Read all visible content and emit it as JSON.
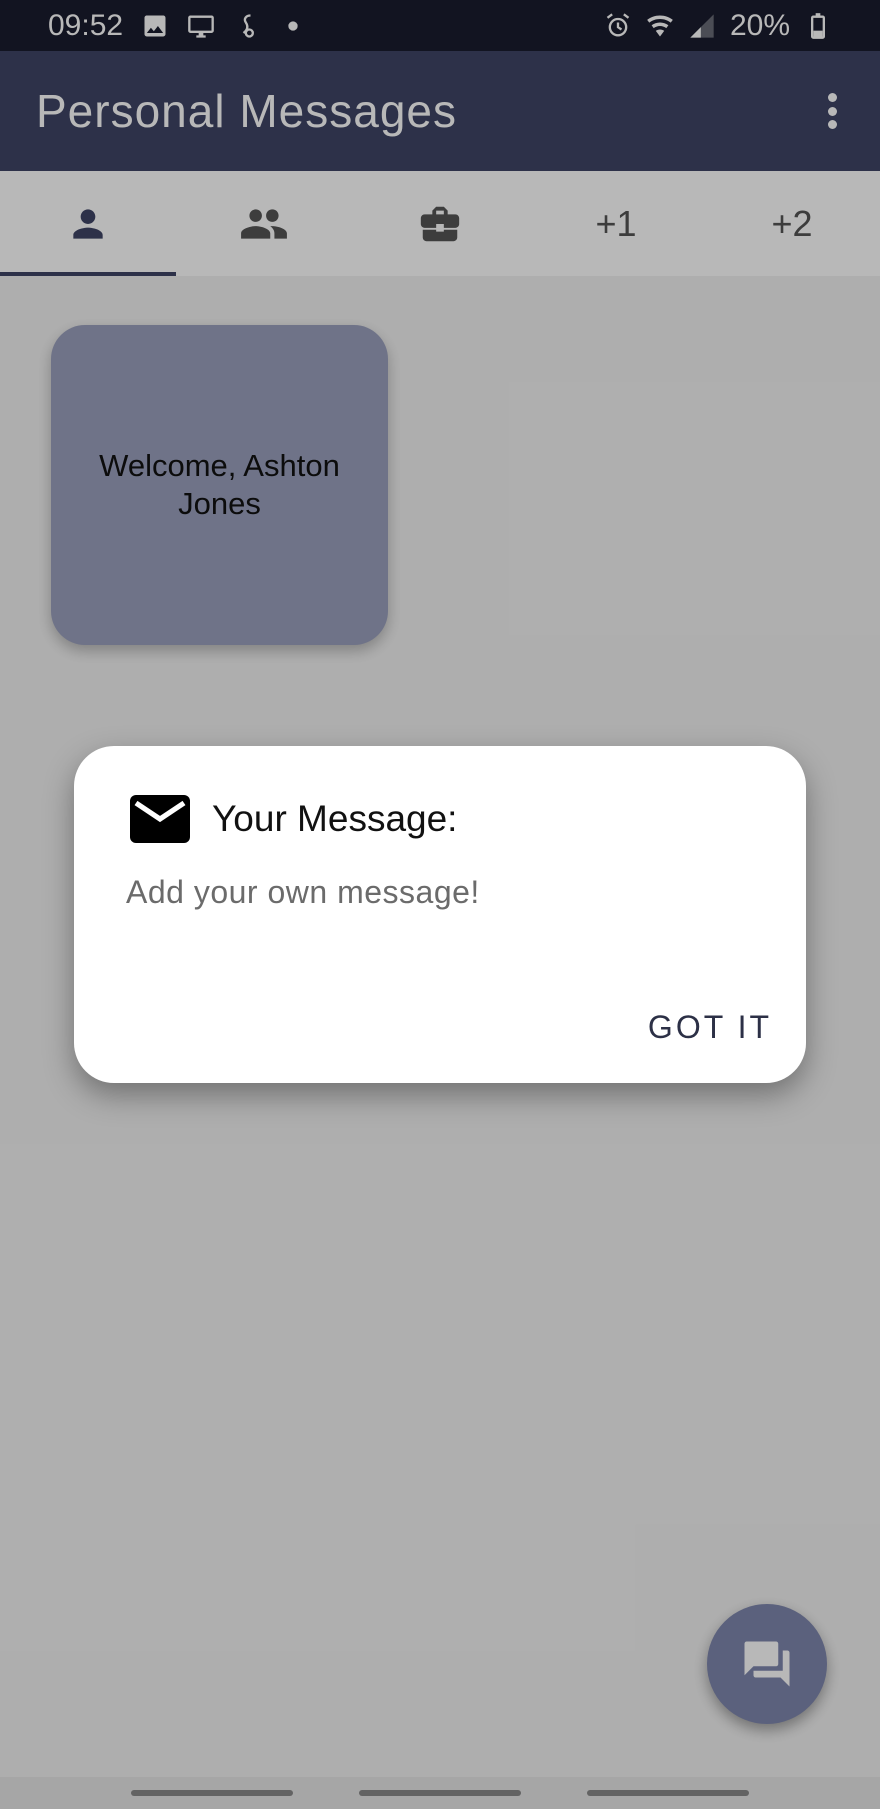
{
  "status_bar": {
    "time": "09:52",
    "battery": "20%",
    "icons_left": [
      "image-icon",
      "cast-icon",
      "s-health-icon",
      "dot-icon"
    ],
    "icons_right": [
      "alarm-icon",
      "wifi-icon",
      "signal-icon",
      "battery-icon"
    ]
  },
  "app_bar": {
    "title": "Personal Messages",
    "menu_icon": "more-vert-icon"
  },
  "tabs": [
    {
      "icon": "person-icon",
      "label": "",
      "active": true
    },
    {
      "icon": "people-icon",
      "label": "",
      "active": false
    },
    {
      "icon": "briefcase-icon",
      "label": "",
      "active": false
    },
    {
      "icon": "",
      "label": "+1",
      "active": false
    },
    {
      "icon": "",
      "label": "+2",
      "active": false
    }
  ],
  "cards": [
    {
      "text": "Welcome, Ashton Jones"
    }
  ],
  "dialog": {
    "icon": "mail-icon",
    "title": "Your Message:",
    "body": "Add your own message!",
    "action": "GOT IT"
  },
  "fab": {
    "icon": "forum-icon"
  },
  "colors": {
    "primary": "#3f4566",
    "card": "#9aa0bd",
    "fab": "#7f87ad"
  }
}
